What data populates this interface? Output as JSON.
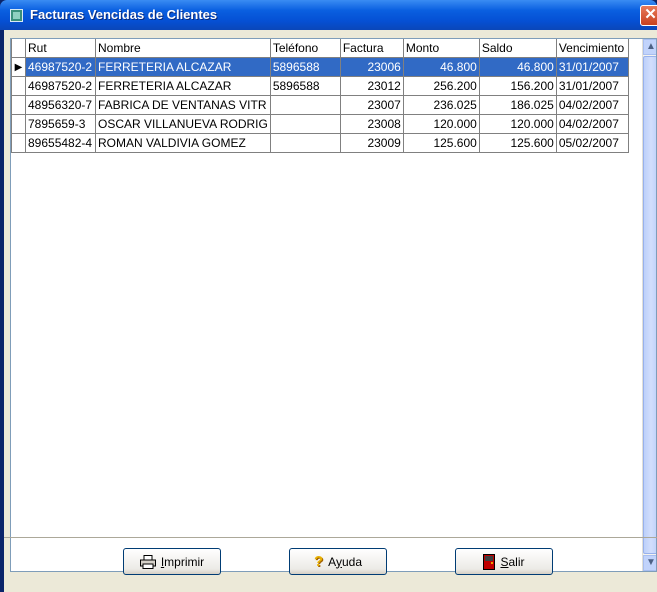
{
  "window": {
    "title": "Facturas Vencidas de Clientes",
    "close_glyph": "✕"
  },
  "table": {
    "columns": [
      "Rut",
      "Nombre",
      "Teléfono",
      "Factura",
      "Monto",
      "Saldo",
      "Vencimiento"
    ],
    "rows": [
      [
        "46987520-2",
        "FERRETERIA ALCAZAR",
        "5896588",
        "23006",
        "46.800",
        "46.800",
        "31/01/2007"
      ],
      [
        "46987520-2",
        "FERRETERIA ALCAZAR",
        "5896588",
        "23012",
        "256.200",
        "156.200",
        "31/01/2007"
      ],
      [
        "48956320-7",
        "FABRICA DE VENTANAS VITR",
        "",
        "23007",
        "236.025",
        "186.025",
        "04/02/2007"
      ],
      [
        "7895659-3",
        "OSCAR VILLANUEVA RODRIG",
        "",
        "23008",
        "120.000",
        "120.000",
        "04/02/2007"
      ],
      [
        "89655482-4",
        "ROMAN VALDIVIA GOMEZ",
        "",
        "23009",
        "125.600",
        "125.600",
        "05/02/2007"
      ]
    ],
    "selected_row": 0
  },
  "buttons": {
    "print": {
      "label_hotkey": "I",
      "label_rest": "mprimir",
      "icon": "printer-icon"
    },
    "help": {
      "label_pre": "A",
      "label_hotkey": "y",
      "label_rest": "uda",
      "icon": "question-icon"
    },
    "exit": {
      "label_hotkey": "S",
      "label_rest": "alir",
      "icon": "exit-door-icon"
    }
  }
}
